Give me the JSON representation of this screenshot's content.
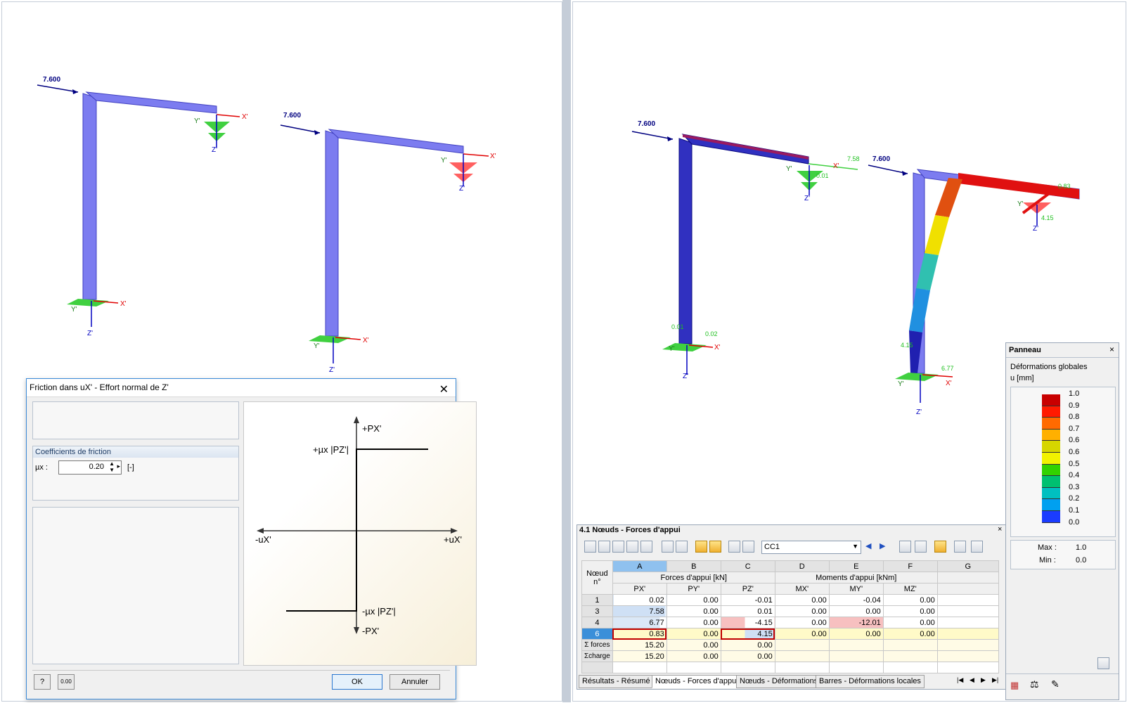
{
  "left_view": {
    "frame1": {
      "load_label": "7.600",
      "axis_x": "X'",
      "axis_y": "Y'",
      "axis_z": "Z'"
    },
    "frame2": {
      "load_label": "7.600",
      "axis_x": "X'",
      "axis_y": "Y'",
      "axis_z": "Z'"
    }
  },
  "right_view": {
    "frame1": {
      "load_label": "7.600",
      "axis_x": "X'",
      "axis_y": "Y'",
      "axis_z": "Z'",
      "reaction_top_x": "7.58",
      "reaction_top_z": "0.01",
      "reaction_base_x": "0.02",
      "reaction_base_z": "0.01"
    },
    "frame2": {
      "load_label": "7.600",
      "axis_x": "X'",
      "axis_y": "Y'",
      "axis_z": "Z'",
      "reaction_top_x": "0.83",
      "reaction_top_z": "4.15",
      "reaction_base_x": "6.77",
      "reaction_base_z": "4.15"
    }
  },
  "dialog": {
    "title": "Friction dans uX' - Effort normal de Z'",
    "group_title": "Coefficients de friction",
    "mu_label": "µx :",
    "mu_value": "0.20",
    "mu_unit": "[-]",
    "diagram": {
      "top": "+PX'",
      "bottom": "-PX'",
      "left": "-uX'",
      "right": "+uX'",
      "upper_level": "+µx |PZ'|",
      "lower_level": "-µx |PZ'|"
    },
    "ok_label": "OK",
    "cancel_label": "Annuler"
  },
  "results": {
    "title": "4.1 Nœuds - Forces d'appui",
    "loadcase": "CC1",
    "col_letters": [
      "A",
      "B",
      "C",
      "D",
      "E",
      "F",
      "G"
    ],
    "group_forces": "Forces d'appui [kN]",
    "group_moments": "Moments d'appui [kNm]",
    "node_header_1": "Nœud",
    "node_header_2": "n°",
    "col_names": [
      "PX'",
      "PY'",
      "PZ'",
      "MX'",
      "MY'",
      "MZ'"
    ],
    "rows": [
      {
        "node": "1",
        "vals": [
          "0.02",
          "0.00",
          "-0.01",
          "0.00",
          "-0.04",
          "0.00"
        ]
      },
      {
        "node": "3",
        "vals": [
          "7.58",
          "0.00",
          "0.01",
          "0.00",
          "0.00",
          "0.00"
        ]
      },
      {
        "node": "4",
        "vals": [
          "6.77",
          "0.00",
          "-4.15",
          "0.00",
          "-12.01",
          "0.00"
        ]
      },
      {
        "node": "6",
        "vals": [
          "0.83",
          "0.00",
          "4.15",
          "0.00",
          "0.00",
          "0.00"
        ]
      },
      {
        "node": "Σ forces",
        "vals": [
          "15.20",
          "0.00",
          "0.00",
          "",
          "",
          ""
        ]
      },
      {
        "node": "Σcharge",
        "vals": [
          "15.20",
          "0.00",
          "0.00",
          "",
          "",
          ""
        ]
      }
    ],
    "tabs": [
      "Résultats - Résumé",
      "Nœuds - Forces d'appui",
      "Nœuds - Déformations",
      "Barres - Déformations locales"
    ]
  },
  "panel": {
    "title": "Panneau",
    "subtitle": "Déformations globales",
    "unit": "u [mm]",
    "scale_labels": [
      "1.0",
      "0.9",
      "0.8",
      "0.7",
      "0.6",
      "0.6",
      "0.5",
      "0.4",
      "0.3",
      "0.2",
      "0.1",
      "0.0"
    ],
    "scale_colors": [
      "#c80000",
      "#ff1a00",
      "#ff6a00",
      "#ffb000",
      "#d6d600",
      "#f2f200",
      "#32d200",
      "#00c070",
      "#00c0c0",
      "#00a0f0",
      "#1a3cff",
      "#0a0a96"
    ],
    "max_label": "Max :",
    "max_value": "1.0",
    "min_label": "Min :",
    "min_value": "0.0"
  }
}
